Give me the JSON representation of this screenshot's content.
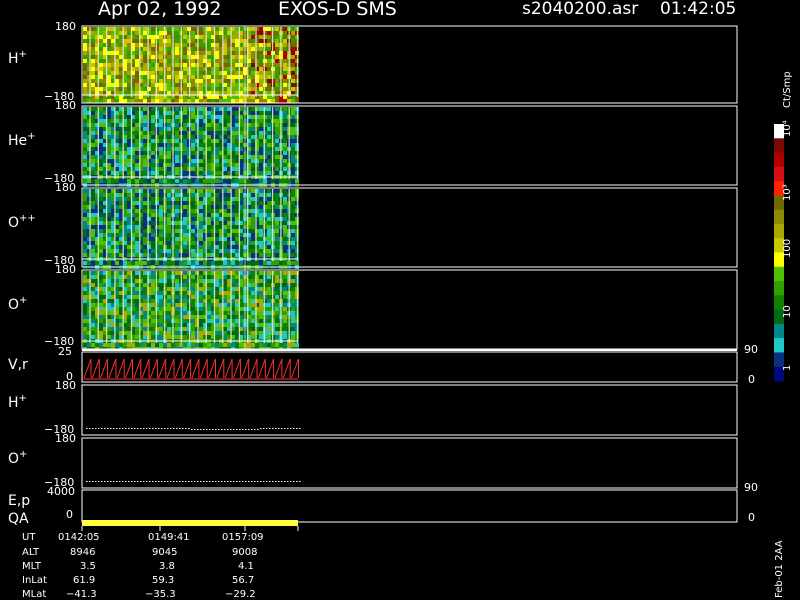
{
  "header": {
    "date": "Apr 02, 1992",
    "instrument": "EXOS-D SMS",
    "file": "s2040200.asr",
    "time": "01:42:05"
  },
  "panels": [
    {
      "label": "H",
      "charge": "+",
      "ymax": "180",
      "ymin": "−180"
    },
    {
      "label": "He",
      "charge": "+",
      "ymax": "180",
      "ymin": "−180"
    },
    {
      "label": "O",
      "charge": "++",
      "ymax": "180",
      "ymin": "−180"
    },
    {
      "label": "O",
      "charge": "+",
      "ymax": "180",
      "ymin": "−180"
    }
  ],
  "vr_panel": {
    "label": "V,r",
    "ymax": "25",
    "ymin": "0",
    "right_max": "90",
    "right_min": "0"
  },
  "line_panels": [
    {
      "label": "H",
      "charge": "+",
      "ymax": "180",
      "ymin": "−180"
    },
    {
      "label": "O",
      "charge": "+",
      "ymax": "180",
      "ymin": "−180"
    }
  ],
  "ep_panel": {
    "label": "E,p",
    "ymax": "4000",
    "ymin": "0",
    "right_max": "90",
    "right_min": "0"
  },
  "qa_label": "QA",
  "colorbar": {
    "unit": "Ct/Smp",
    "labels": [
      "10⁴",
      "10³",
      "100",
      "10",
      "1"
    ],
    "colors": [
      "#ffffff",
      "#7a0a00",
      "#b00000",
      "#d61010",
      "#ff2200",
      "#706800",
      "#8c8a00",
      "#a8a800",
      "#c8c800",
      "#ffff00",
      "#50c000",
      "#30a000",
      "#108000",
      "#006818",
      "#008888",
      "#20c8c8",
      "#0a3080",
      "#000880"
    ]
  },
  "footer": {
    "rows": [
      {
        "name": "UT",
        "values": [
          "0142:05",
          "0149:41",
          "0157:09"
        ]
      },
      {
        "name": "ALT",
        "values": [
          "8946",
          "9045",
          "9008"
        ]
      },
      {
        "name": "MLT",
        "values": [
          "3.5",
          "3.8",
          "4.1"
        ]
      },
      {
        "name": "InLat",
        "values": [
          "61.9",
          "59.3",
          "56.7"
        ]
      },
      {
        "name": "MLat",
        "values": [
          "−41.3",
          "−35.3",
          "−29.2"
        ]
      }
    ],
    "stamp": "Feb-01 2AA"
  },
  "chart_data": {
    "type": "heatmap",
    "title": "Apr 02, 1992   EXOS-D SMS",
    "x_ticks": [
      "0142:05",
      "0149:41",
      "0157:09"
    ],
    "y_range_deg": [
      -180,
      180
    ],
    "species_panels": [
      "H+",
      "He+",
      "O++",
      "O+"
    ],
    "color_scale": {
      "unit": "Ct/Smp",
      "log": true,
      "range": [
        1,
        10000
      ]
    }
  }
}
